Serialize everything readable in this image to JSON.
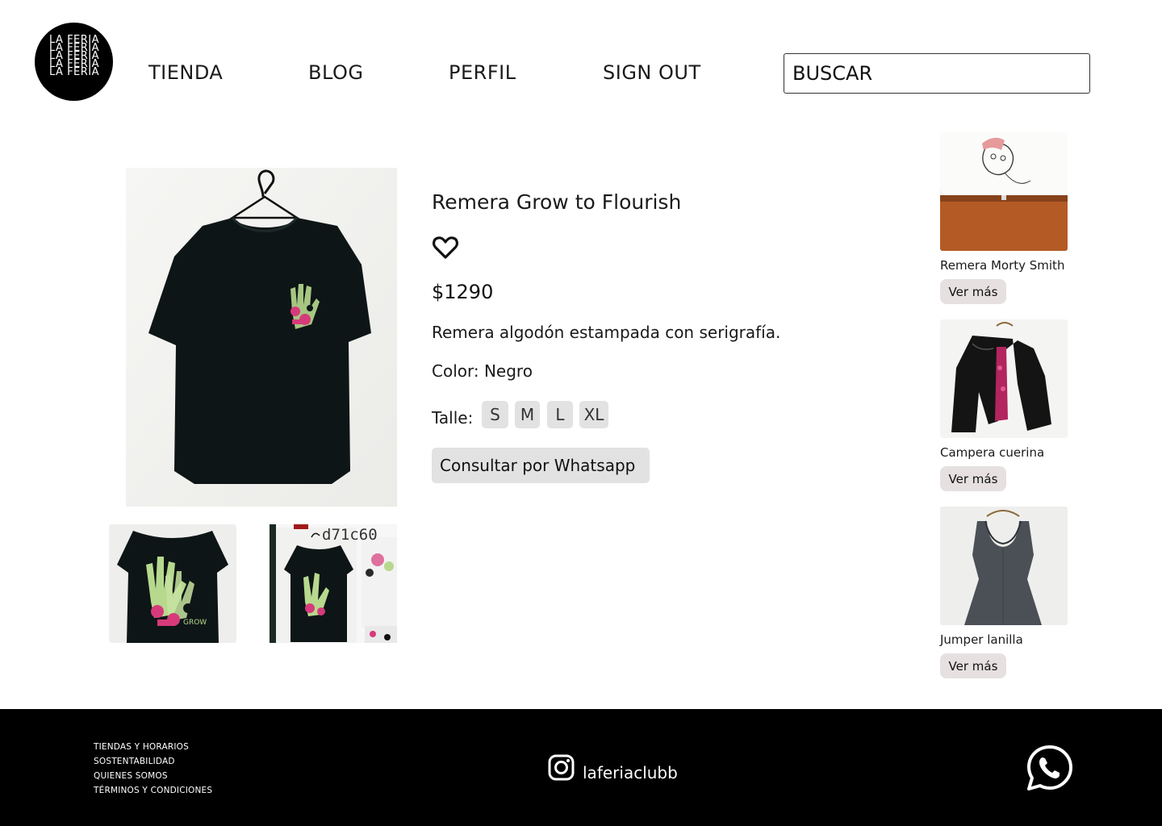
{
  "brand": {
    "logo_lines": [
      "LA FERIA",
      "LA FERIA",
      "LA FERIA",
      "LA FERIA",
      "LA FERIA"
    ]
  },
  "nav": {
    "items": [
      {
        "label": "TIENDA"
      },
      {
        "label": "BLOG"
      },
      {
        "label": "PERFIL"
      },
      {
        "label": "SIGN OUT"
      }
    ]
  },
  "search": {
    "placeholder": "BUSCAR"
  },
  "product": {
    "title": "Remera Grow to Flourish",
    "price": "$1290",
    "description": "Remera algodón estampada con serigrafía.",
    "color": "Color: Negro",
    "size_label": "Talle:",
    "sizes": [
      "S",
      "M",
      "L",
      "XL"
    ],
    "whatsapp_label": "Consultar por Whatsapp",
    "thumb_caption": "d71c60"
  },
  "related": [
    {
      "name": "Remera Morty Smith",
      "button": "Ver más"
    },
    {
      "name": "Campera cuerina",
      "button": "Ver más"
    },
    {
      "name": "Jumper lanilla",
      "button": "Ver más"
    }
  ],
  "footer": {
    "links": [
      "TIENDAS Y HORARIOS",
      "SOSTENTABILIDAD",
      "QUIENES SOMOS",
      "TÉRMINOS Y CONDICIONES"
    ],
    "instagram_handle": "laferiaclubb"
  },
  "colors": {
    "footer_bg": "#000000",
    "button_bg": "#e2e2e2",
    "related_button_bg": "#e6e0e0",
    "print_pink": "#d63a7a",
    "print_green": "#b7d98e"
  }
}
